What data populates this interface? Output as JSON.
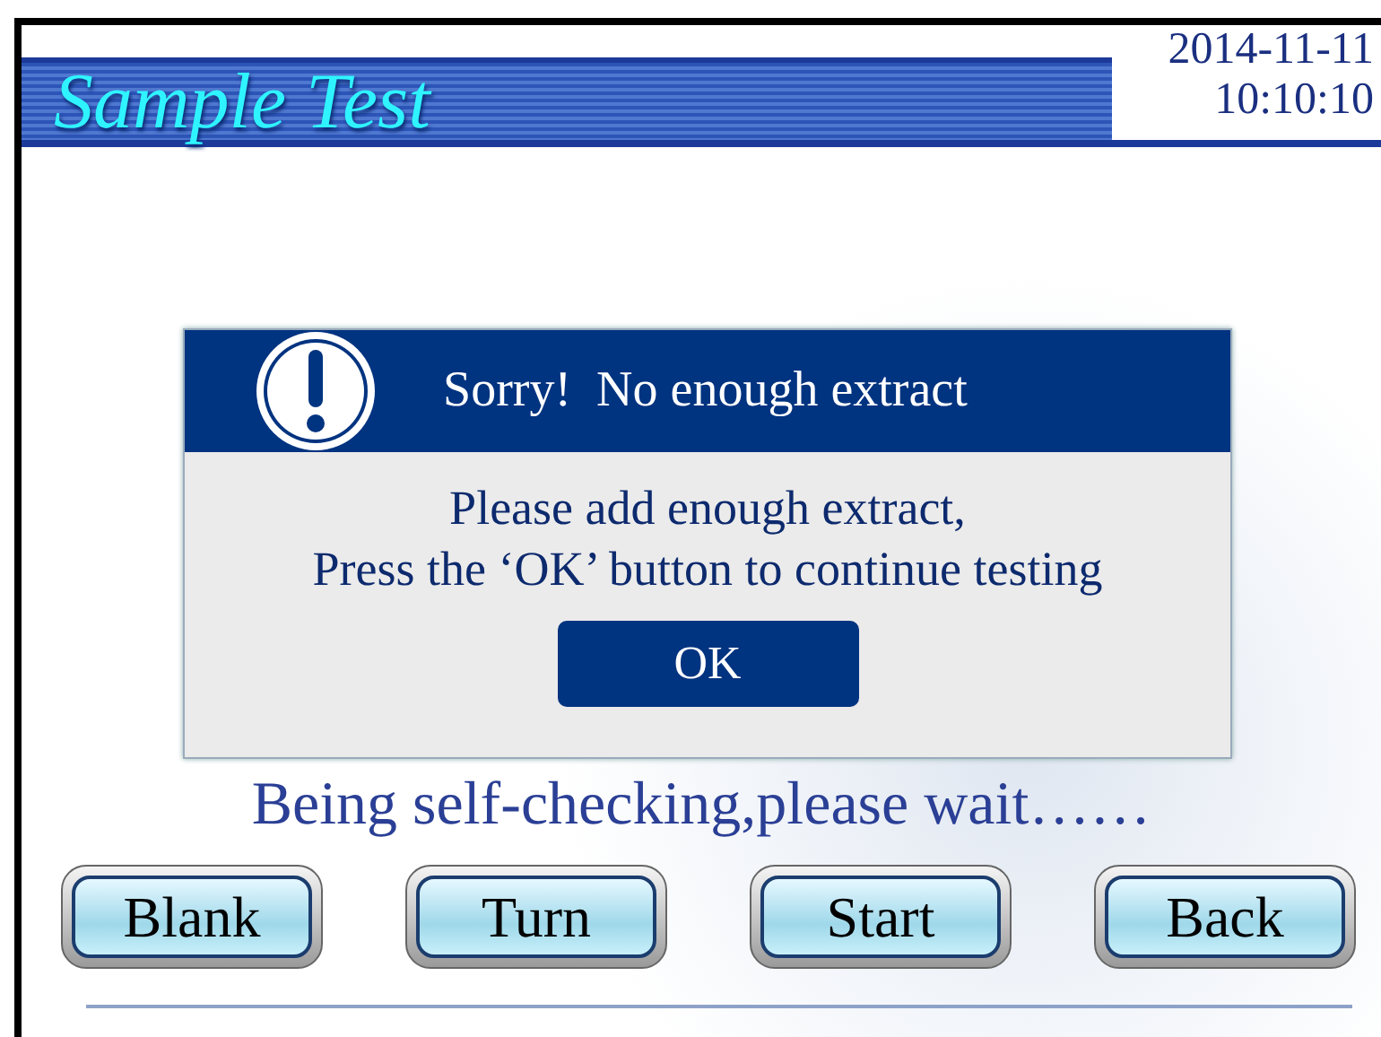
{
  "header": {
    "title": "Sample Test",
    "date": "2014-11-11",
    "time": "10:10:10"
  },
  "status": "Being self-checking,please wait……",
  "dialog": {
    "title": "Sorry!  No enough extract",
    "lines": [
      "Please add enough extract,",
      "Press the ‘OK’ button to continue testing"
    ],
    "button": "OK"
  },
  "buttons": [
    "Blank",
    "Turn",
    "Start",
    "Back"
  ]
}
